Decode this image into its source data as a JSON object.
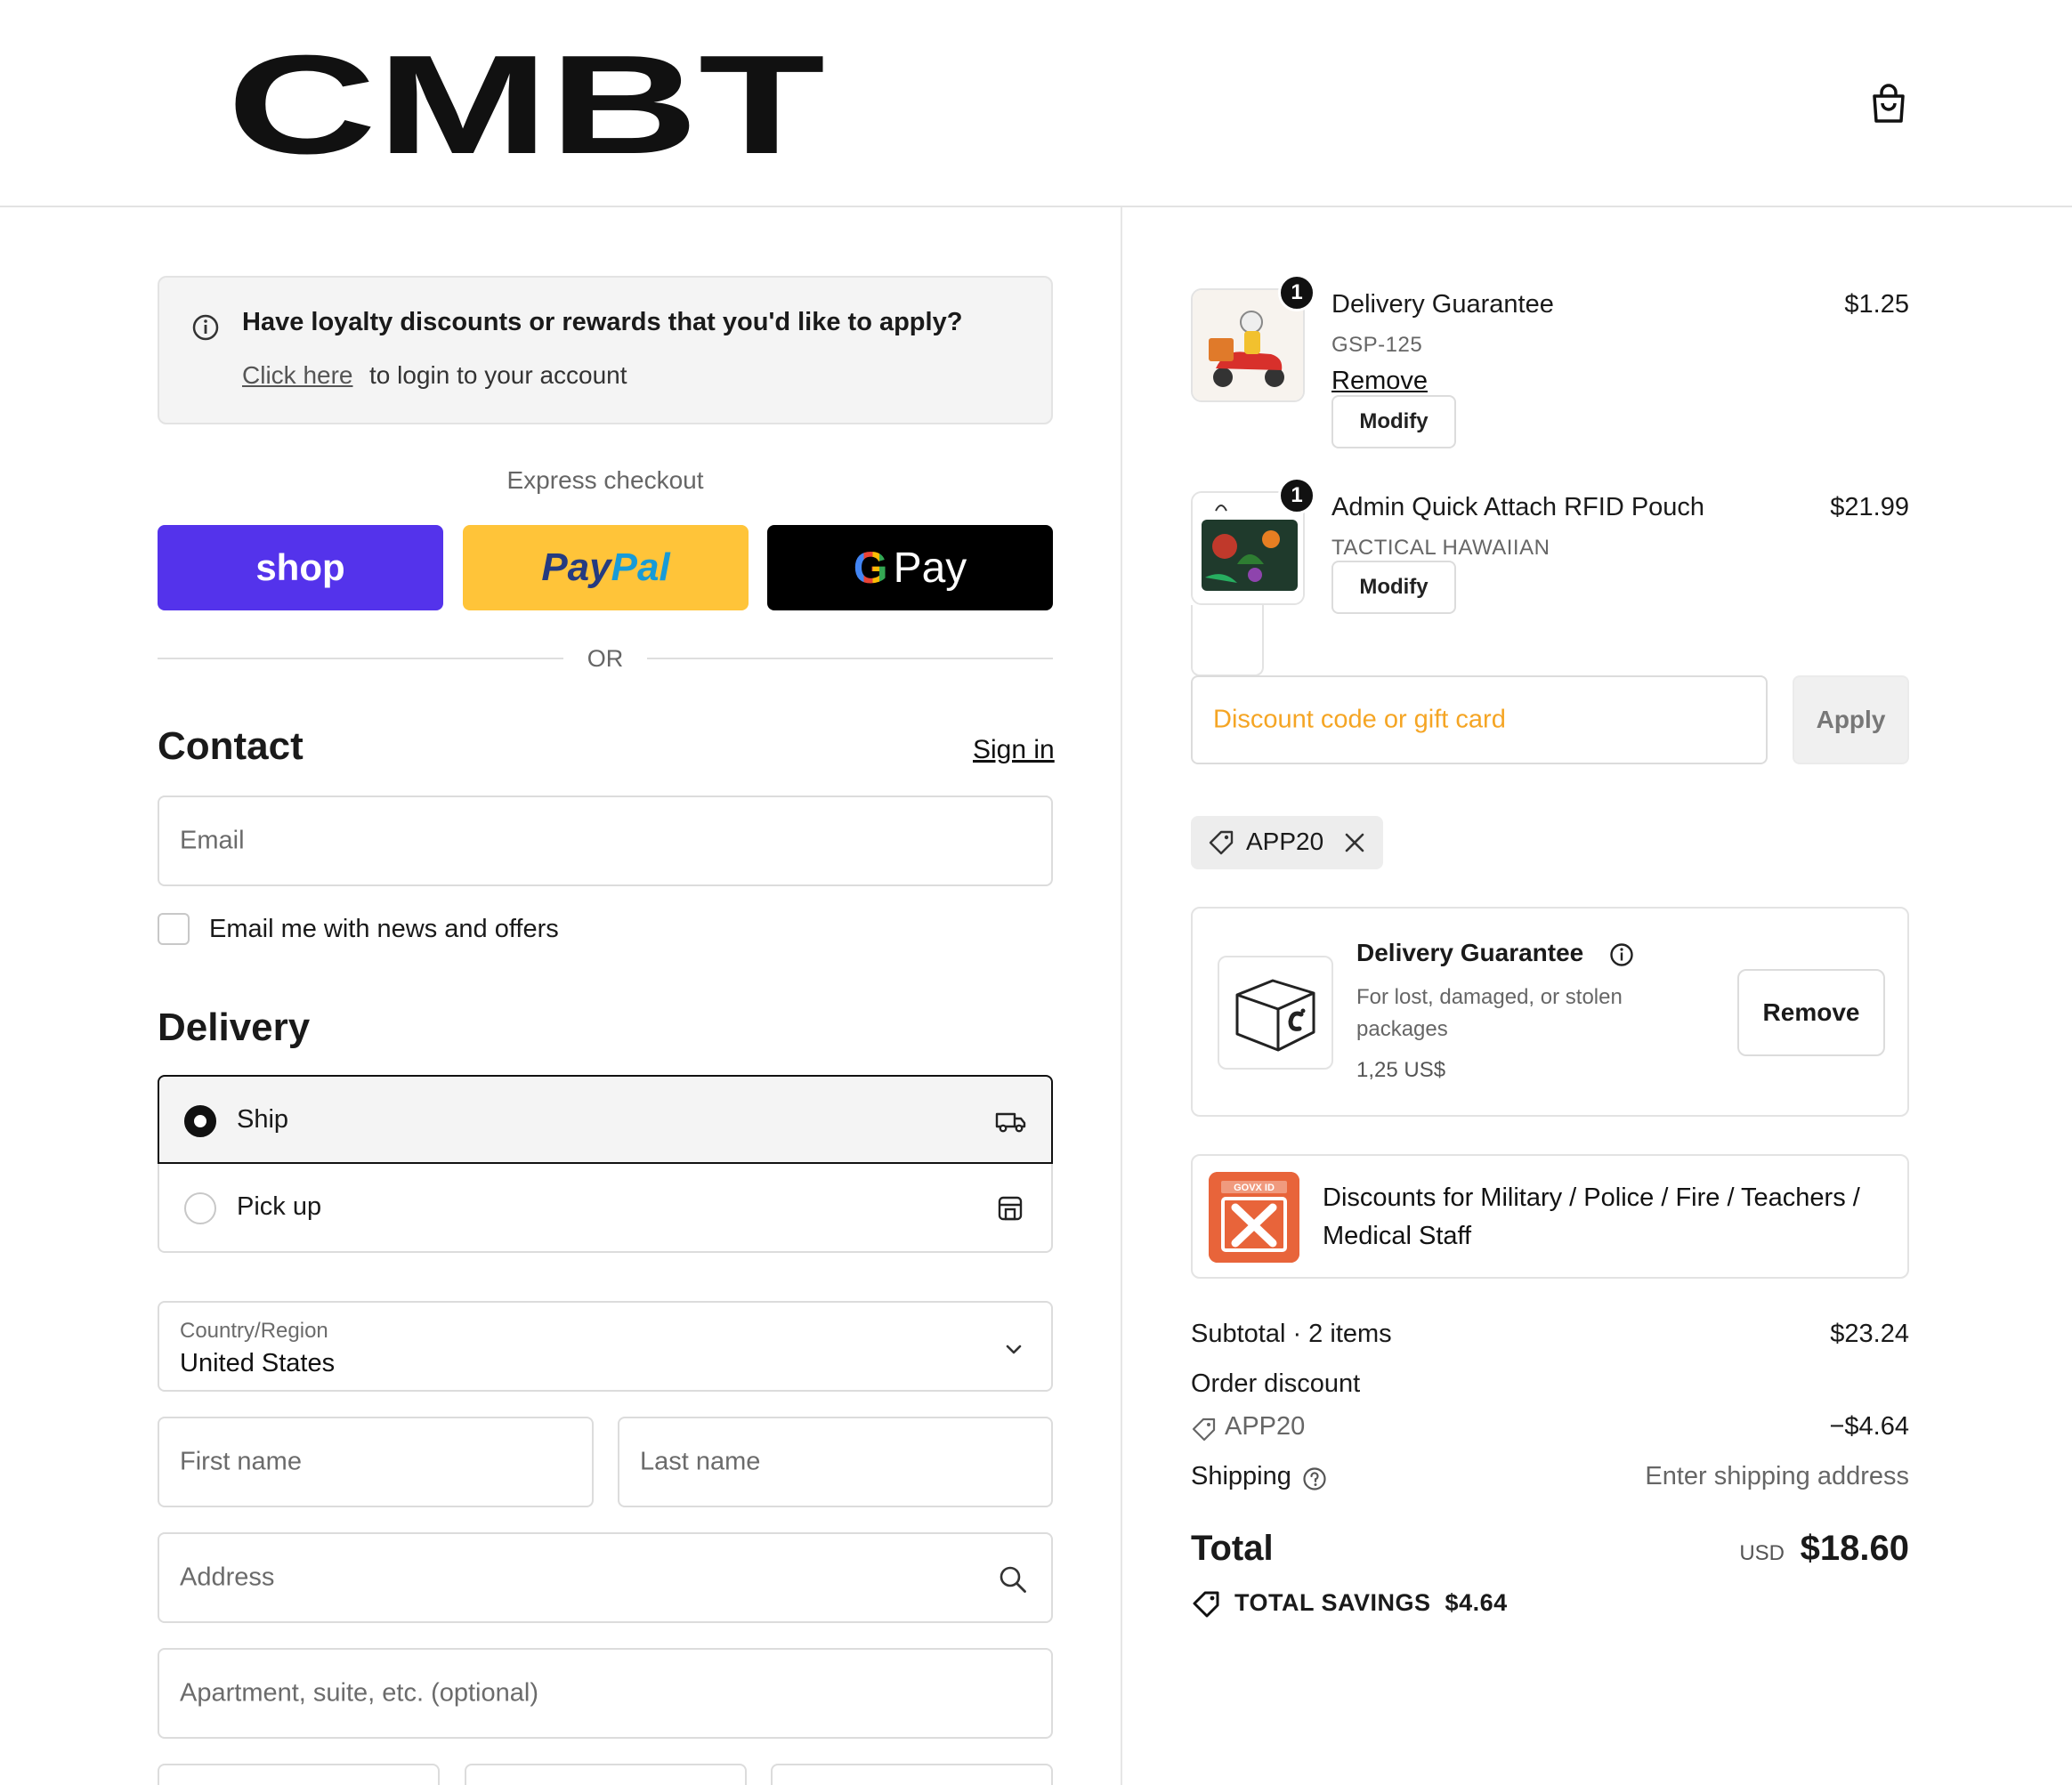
{
  "brand": {
    "logo_text": "CMBT"
  },
  "loyalty": {
    "title": "Have loyalty discounts or rewards that you'd like to apply?",
    "link": "Click here",
    "rest": "to login to your account"
  },
  "express": {
    "label": "Express checkout",
    "shop": "shop",
    "paypal_a": "Pay",
    "paypal_b": "Pal",
    "gpay_g": "G",
    "gpay_text": "Pay",
    "or": "OR"
  },
  "contact": {
    "heading": "Contact",
    "sign_in": "Sign in",
    "email_placeholder": "Email",
    "newsletter_label": "Email me with news and offers"
  },
  "delivery": {
    "heading": "Delivery",
    "options": [
      {
        "label": "Ship",
        "selected": true
      },
      {
        "label": "Pick up",
        "selected": false
      }
    ],
    "country_label": "Country/Region",
    "country_value": "United States",
    "first_name_placeholder": "First name",
    "last_name_placeholder": "Last name",
    "address_placeholder": "Address",
    "apartment_placeholder": "Apartment, suite, etc. (optional)"
  },
  "cart": {
    "items": [
      {
        "qty": "1",
        "name": "Delivery Guarantee",
        "sku": "GSP-125",
        "price": "$1.25",
        "remove": "Remove",
        "modify": "Modify"
      },
      {
        "qty": "1",
        "name": "Admin Quick Attach RFID Pouch",
        "variant": "TACTICAL HAWAIIAN",
        "price": "$21.99",
        "modify": "Modify"
      }
    ]
  },
  "discount": {
    "placeholder": "Discount code or gift card",
    "apply": "Apply",
    "applied_code": "APP20"
  },
  "guarantee_card": {
    "title": "Delivery Guarantee",
    "description": "For lost, damaged, or stolen packages",
    "amount": "1,25 US$",
    "remove": "Remove"
  },
  "military_card": {
    "logo_text": "GOVX ID",
    "text": "Discounts for Military / Police / Fire / Teachers / Medical Staff"
  },
  "summary": {
    "subtotal_label": "Subtotal · 2 items",
    "subtotal_value": "$23.24",
    "order_discount_label": "Order discount",
    "discount_code": "APP20",
    "discount_value": "−$4.64",
    "shipping_label": "Shipping",
    "shipping_value": "Enter shipping address",
    "total_label": "Total",
    "currency": "USD",
    "total_value": "$18.60",
    "savings_label": "TOTAL SAVINGS",
    "savings_value": "$4.64"
  },
  "colors": {
    "shop_purple": "#5433eb",
    "paypal_yellow": "#ffc439",
    "gpay_black": "#000000",
    "discount_placeholder": "#f5a524",
    "govx_orange": "#e8643a"
  },
  "icons": [
    "cart-bag-icon",
    "info-icon",
    "truck-icon",
    "store-icon",
    "chevron-down-icon",
    "search-icon",
    "tag-icon",
    "close-icon",
    "box-icon",
    "savings-tag-icon"
  ]
}
